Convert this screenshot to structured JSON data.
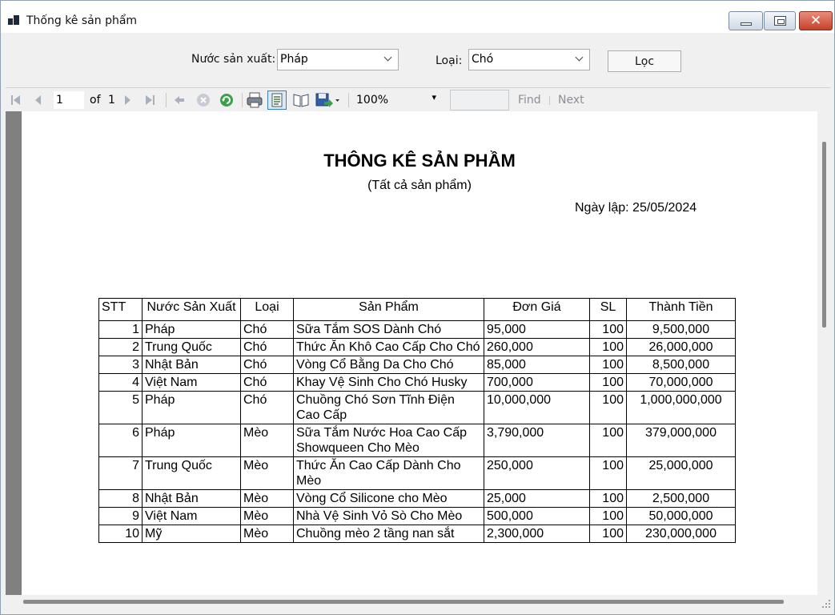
{
  "window": {
    "title": "Thống kê sản phẩm"
  },
  "filters": {
    "country_label": "Nước sản xuất:",
    "country_value": "Pháp",
    "type_label": "Loại:",
    "type_value": "Chó",
    "filter_button": "Lọc"
  },
  "toolbar": {
    "page_current": "1",
    "page_of": "of",
    "page_total": "1",
    "zoom": "100%",
    "find_label": "Find",
    "next_label": "Next"
  },
  "report": {
    "title": "THÔNG KÊ SẢN PHẦM",
    "subtitle": "(Tất cả sản phẩm)",
    "date_line": "Ngày lập: 25/05/2024",
    "columns": [
      "STT",
      "Nước Sản Xuất",
      "Loại",
      "Sản Phẩm",
      "Đơn Giá",
      "SL",
      "Thành Tiền"
    ],
    "rows": [
      [
        "1",
        "Pháp",
        "Chó",
        "Sữa Tắm SOS Dành Chó",
        "95,000",
        "100",
        "9,500,000"
      ],
      [
        "2",
        "Trung Quốc",
        "Chó",
        "Thức Ăn Khô Cao Cấp Cho Chó",
        "260,000",
        "100",
        "26,000,000"
      ],
      [
        "3",
        "Nhật Bản",
        "Chó",
        "Vòng Cổ Bằng Da Cho Chó",
        "85,000",
        "100",
        "8,500,000"
      ],
      [
        "4",
        "Việt Nam",
        "Chó",
        "Khay Vệ Sinh Cho Chó Husky",
        "700,000",
        "100",
        "70,000,000"
      ],
      [
        "5",
        "Pháp",
        "Chó",
        "Chuồng Chó Sơn Tĩnh Điện Cao Cấp",
        "10,000,000",
        "100",
        "1,000,000,000"
      ],
      [
        "6",
        "Pháp",
        "Mèo",
        "Sữa Tắm Nước Hoa Cao Cấp Showqueen Cho Mèo",
        "3,790,000",
        "100",
        "379,000,000"
      ],
      [
        "7",
        "Trung Quốc",
        "Mèo",
        "Thức Ăn Cao Cấp Dành Cho Mèo",
        "250,000",
        "100",
        "25,000,000"
      ],
      [
        "8",
        "Nhật Bản",
        "Mèo",
        "Vòng Cổ Silicone cho Mèo",
        "25,000",
        "100",
        "2,500,000"
      ],
      [
        "9",
        "Việt Nam",
        "Mèo",
        "Nhà Vệ Sinh Vỏ Sò Cho Mèo",
        "500,000",
        "100",
        "50,000,000"
      ],
      [
        "10",
        "Mỹ",
        "Mèo",
        "Chuồng mèo 2 tầng nan sắt",
        "2,300,000",
        "100",
        "230,000,000"
      ]
    ]
  }
}
